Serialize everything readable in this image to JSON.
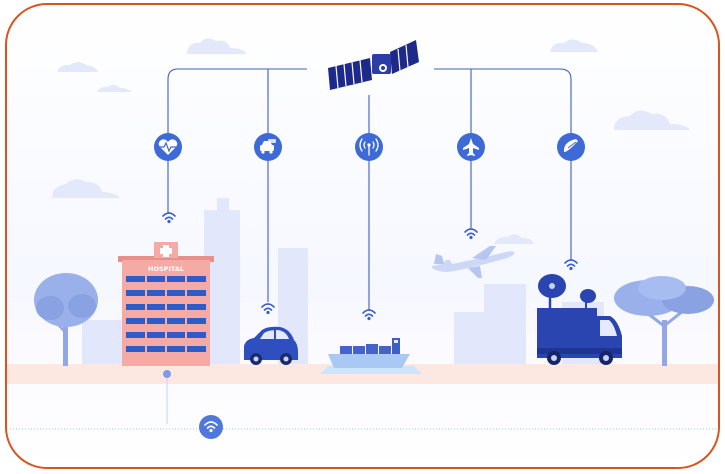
{
  "hospital": {
    "sign": "HOSPITAL"
  },
  "colors": {
    "frame_border": "#d9541f",
    "primary_blue": "#3b5fc4",
    "node_blue": "#3d6ad6",
    "hospital_pink": "#f6aaa5",
    "ground_peach": "#fde7e1",
    "building_lavender": "#e3e7fb",
    "tree_blue": "#93a7e6"
  },
  "links": [
    {
      "source": "satellite",
      "target": "hospital",
      "node_icon": "heart-pulse-icon"
    },
    {
      "source": "satellite",
      "target": "car",
      "node_icon": "car-icon"
    },
    {
      "source": "satellite",
      "target": "ship",
      "node_icon": "antenna-signal-icon"
    },
    {
      "source": "satellite",
      "target": "airplane",
      "node_icon": "airplane-icon"
    },
    {
      "source": "satellite",
      "target": "broadcast-van",
      "node_icon": "satellite-dish-icon"
    }
  ]
}
